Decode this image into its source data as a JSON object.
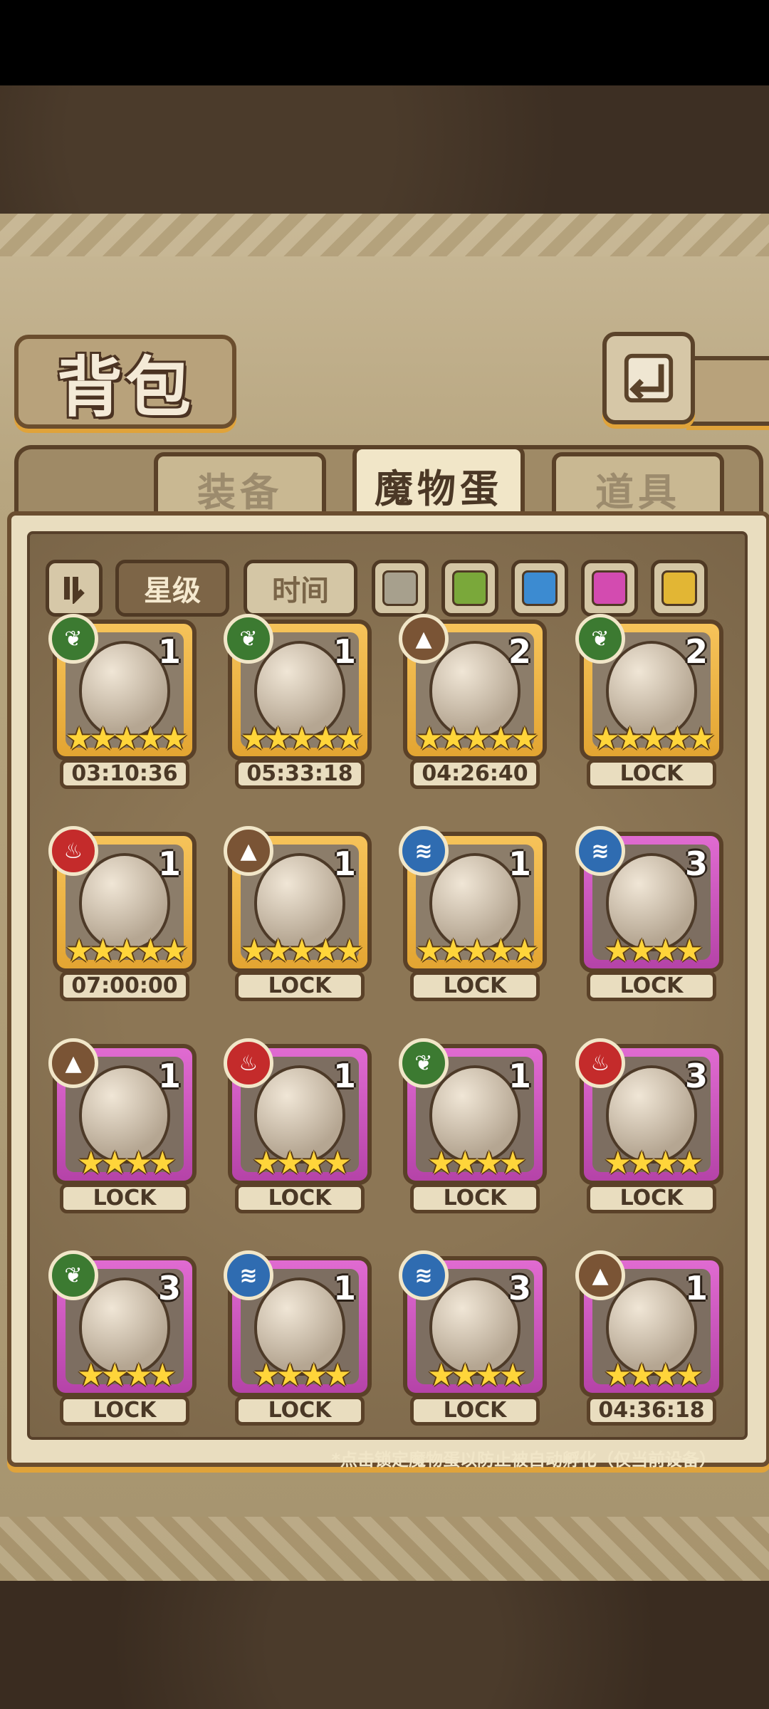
{
  "colors": {
    "gold_frame": "#e3a532",
    "purple_frame": "#b543a8",
    "leaf": "#3c7a31",
    "fire": "#c42b2b",
    "water": "#2f6cb1",
    "earth": "#7a5435"
  },
  "header": {
    "title": "背包",
    "back_icon": "back-arrow-icon"
  },
  "tabs": [
    {
      "label": "装备",
      "active": false
    },
    {
      "label": "魔物蛋",
      "active": true
    },
    {
      "label": "道具",
      "active": false
    }
  ],
  "filters": {
    "sort_icon": "sort-toggle-icon",
    "star_label": "星级",
    "time_label": "时间",
    "colors": [
      "#a7a08d",
      "#7aa83a",
      "#3c8bd1",
      "#d34bb0",
      "#e2b634"
    ]
  },
  "eggs": [
    {
      "element": "leaf",
      "count": "1",
      "stars": 5,
      "rarity": "gold",
      "status": "03:10:36"
    },
    {
      "element": "leaf",
      "count": "1",
      "stars": 5,
      "rarity": "gold",
      "status": "05:33:18"
    },
    {
      "element": "earth",
      "count": "2",
      "stars": 5,
      "rarity": "gold",
      "status": "04:26:40"
    },
    {
      "element": "leaf",
      "count": "2",
      "stars": 5,
      "rarity": "gold",
      "status": "LOCK"
    },
    {
      "element": "fire",
      "count": "1",
      "stars": 5,
      "rarity": "gold",
      "status": "07:00:00"
    },
    {
      "element": "earth",
      "count": "1",
      "stars": 5,
      "rarity": "gold",
      "status": "LOCK"
    },
    {
      "element": "water",
      "count": "1",
      "stars": 5,
      "rarity": "gold",
      "status": "LOCK"
    },
    {
      "element": "water",
      "count": "3",
      "stars": 4,
      "rarity": "purple",
      "status": "LOCK"
    },
    {
      "element": "earth",
      "count": "1",
      "stars": 4,
      "rarity": "purple",
      "status": "LOCK"
    },
    {
      "element": "fire",
      "count": "1",
      "stars": 4,
      "rarity": "purple",
      "status": "LOCK"
    },
    {
      "element": "leaf",
      "count": "1",
      "stars": 4,
      "rarity": "purple",
      "status": "LOCK"
    },
    {
      "element": "fire",
      "count": "3",
      "stars": 4,
      "rarity": "purple",
      "status": "LOCK"
    },
    {
      "element": "leaf",
      "count": "3",
      "stars": 4,
      "rarity": "purple",
      "status": "LOCK"
    },
    {
      "element": "water",
      "count": "1",
      "stars": 4,
      "rarity": "purple",
      "status": "LOCK"
    },
    {
      "element": "water",
      "count": "3",
      "stars": 4,
      "rarity": "purple",
      "status": "LOCK"
    },
    {
      "element": "earth",
      "count": "1",
      "stars": 4,
      "rarity": "purple",
      "status": "04:36:18"
    }
  ],
  "footer_note": "*点击锁定魔物蛋以防止被自动孵化（仅当前设备）"
}
